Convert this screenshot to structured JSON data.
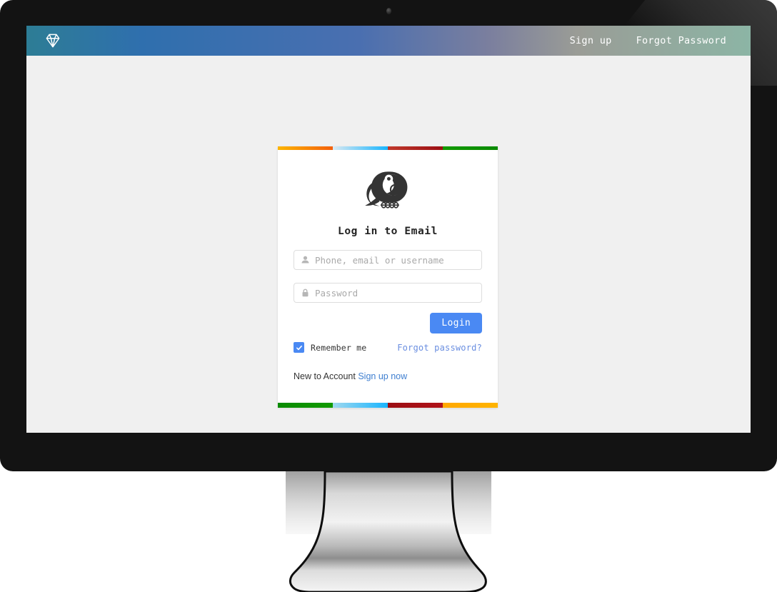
{
  "device": {
    "type": "desktop-monitor",
    "bezel_color": "#131313",
    "webcam": "webcam-dot"
  },
  "screen": {
    "background_color": "#f0f0f0"
  },
  "navbar": {
    "brand_icon": "diamond-icon",
    "gradient_start": "#2d7d95",
    "gradient_mid": "#4a6fb0",
    "gradient_end": "#8cb5a5",
    "links": [
      {
        "label": "Sign up",
        "name": "nav-link-sign-up"
      },
      {
        "label": "Forgot Password",
        "name": "nav-link-forgot-password"
      }
    ]
  },
  "login_card": {
    "logo_icon": "bird-logo-icon",
    "title": "Log in to Email",
    "top_stripes": [
      "#f4600c",
      "#19b5fe",
      "#9b0e13",
      "#0a8a00"
    ],
    "bottom_stripes": [
      "#0a8a00",
      "#19b5fe",
      "#9b0e13",
      "#ffa800"
    ],
    "username_field": {
      "icon": "user-icon",
      "placeholder": "Phone, email or username",
      "value": ""
    },
    "password_field": {
      "icon": "lock-icon",
      "placeholder": "Password",
      "value": ""
    },
    "login_button": {
      "label": "Login",
      "color": "#4a89f3"
    },
    "remember_me": {
      "label": "Remember me",
      "checked": true,
      "checkbox_color": "#4a89f3",
      "check_icon": "checkmark-icon"
    },
    "forgot_password_link": {
      "label": "Forgot password?",
      "color": "#6a8ee0"
    },
    "signup_prompt": {
      "text": "New to Account",
      "link_label": "Sign up now",
      "link_color": "#3f7fd0"
    }
  }
}
